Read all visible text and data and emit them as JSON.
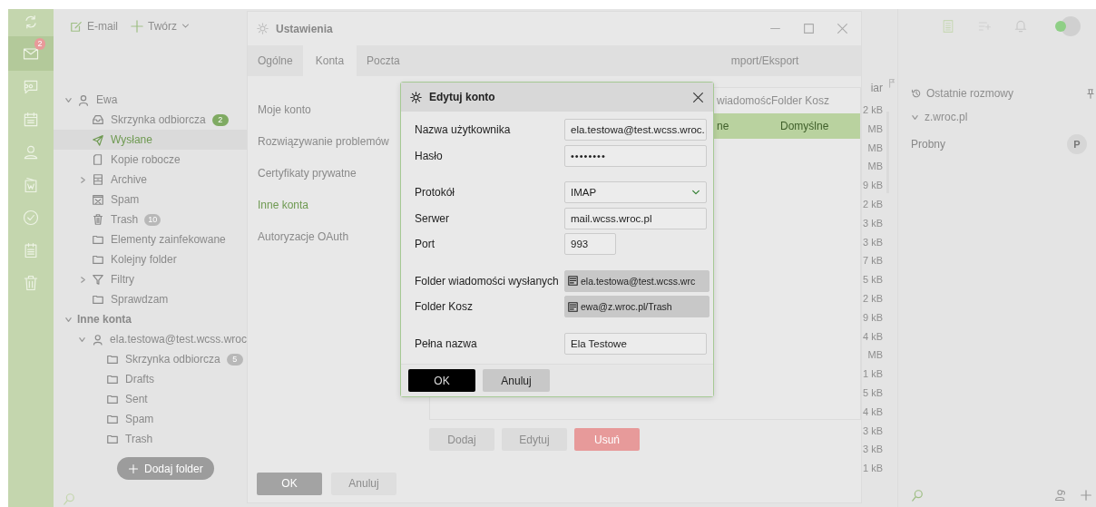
{
  "nav_rail": {
    "items": [
      {
        "kind": "sync",
        "selected": false
      },
      {
        "kind": "mail",
        "selected": true,
        "badge": "2"
      },
      {
        "kind": "chat",
        "selected": false
      },
      {
        "kind": "calendar",
        "selected": false
      },
      {
        "kind": "contacts",
        "selected": false
      },
      {
        "kind": "document",
        "selected": false
      },
      {
        "kind": "tasks",
        "selected": false
      },
      {
        "kind": "notes",
        "selected": false
      },
      {
        "kind": "trash",
        "selected": false
      }
    ]
  },
  "toolbar": {
    "email": "E-mail",
    "create": "Twórz"
  },
  "folders": {
    "tree": [
      {
        "kind": "account",
        "name": "Ewa",
        "expanded": true,
        "children": [
          {
            "kind": "inbox",
            "name": "Skrzynka odbiorcza",
            "badge": "2",
            "badge_highlighted": true,
            "selected": false
          },
          {
            "kind": "sent",
            "name": "Wysłane",
            "selected": true
          },
          {
            "kind": "drafts",
            "name": "Kopie robocze",
            "selected": false
          },
          {
            "kind": "archive",
            "name": "Archive",
            "expanded": false,
            "selected": false
          },
          {
            "kind": "spam",
            "name": "Spam",
            "selected": false
          },
          {
            "kind": "trash",
            "name": "Trash",
            "badge": "10",
            "badge_highlighted": false,
            "selected": false
          },
          {
            "kind": "folder",
            "name": "Elementy zainfekowane",
            "selected": false
          },
          {
            "kind": "folder",
            "name": "Kolejny folder",
            "selected": false
          },
          {
            "kind": "filter",
            "name": "Filtry",
            "expanded": false,
            "selected": false
          },
          {
            "kind": "folder",
            "name": "Sprawdzam",
            "selected": false
          }
        ]
      },
      {
        "kind": "group",
        "name": "Inne konta",
        "expanded": true,
        "children": [
          {
            "kind": "account",
            "name": "ela.testowa@test.wcss.wroc",
            "expanded": true,
            "children": [
              {
                "kind": "folder",
                "name": "Skrzynka odbiorcza",
                "badge": "5",
                "badge_highlighted": false,
                "selected": false
              },
              {
                "kind": "folder",
                "name": "Drafts",
                "selected": false
              },
              {
                "kind": "folder",
                "name": "Sent",
                "selected": false
              },
              {
                "kind": "folder",
                "name": "Spam",
                "selected": false
              },
              {
                "kind": "folder",
                "name": "Trash",
                "selected": false
              }
            ]
          }
        ]
      }
    ],
    "add_button": "Dodaj folder"
  },
  "message_list": {
    "size_header": "iar",
    "sizes": [
      "2 kB",
      "MB",
      "MB",
      "MB",
      "9 kB",
      "2 kB",
      "3 kB",
      "3 kB",
      "7 kB",
      "5 kB",
      "2 kB",
      "9 kB",
      "4 kB",
      "MB",
      "1 kB",
      "5 kB",
      "4 kB",
      "3 kB",
      "3 kB",
      "1 kB"
    ]
  },
  "user_status": {
    "online": true
  },
  "conversations": {
    "title": "Ostatnie rozmowy",
    "group": "z.wroc.pl",
    "expanded": true,
    "items": [
      {
        "name": "Probny",
        "initial": "P"
      }
    ]
  },
  "settings": {
    "title": "Ustawienia",
    "tabs": [
      {
        "label": "Ogólne",
        "selected": false
      },
      {
        "label": "Konta",
        "selected": true
      },
      {
        "label": "Poczta",
        "selected": false
      },
      {
        "label": "mport/Eksport",
        "selected": false
      }
    ],
    "menu": [
      {
        "label": "Moje konto",
        "selected": false
      },
      {
        "label": "Rozwiązywanie problemów",
        "selected": false
      },
      {
        "label": "Certyfikaty prywatne",
        "selected": false
      },
      {
        "label": "Inne konta",
        "selected": true
      },
      {
        "label": "Autoryzacje OAuth",
        "selected": false
      }
    ],
    "accounts_table": {
      "columns": [
        "wiadomośc",
        "Folder Kosz"
      ],
      "rows": [
        {
          "cells": [
            "ne",
            "Domyślne"
          ],
          "selected": true
        }
      ]
    },
    "actions": [
      {
        "label": "Dodaj",
        "kind": "neutral",
        "disabled": true
      },
      {
        "label": "Edytuj",
        "kind": "neutral",
        "disabled": true
      },
      {
        "label": "Usuń",
        "kind": "danger",
        "disabled": false
      }
    ],
    "footer": [
      {
        "label": "OK",
        "kind": "primary"
      },
      {
        "label": "Anuluj",
        "kind": "secondary"
      }
    ]
  },
  "edit_dialog": {
    "title": "Edytuj konto",
    "sections": [
      [
        {
          "label": "Nazwa użytkownika",
          "value": "ela.testowa@test.wcss.wroc.",
          "kind": "text"
        },
        {
          "label": "Hasło",
          "value": "••••••••",
          "kind": "password"
        }
      ],
      [
        {
          "label": "Protokół",
          "value": "IMAP",
          "kind": "select"
        },
        {
          "label": "Serwer",
          "value": "mail.wcss.wroc.pl",
          "kind": "text"
        },
        {
          "label": "Port",
          "value": "993",
          "kind": "number"
        }
      ],
      [
        {
          "label": "Folder wiadomości wysłanych",
          "value": "ela.testowa@test.wcss.wrc",
          "kind": "folder"
        },
        {
          "label": "Folder Kosz",
          "value": "ewa@z.wroc.pl/Trash",
          "kind": "folder"
        }
      ],
      [
        {
          "label": "Pełna nazwa",
          "value": "Ela Testowe",
          "kind": "text"
        }
      ]
    ],
    "buttons": [
      {
        "label": "OK",
        "kind": "primary"
      },
      {
        "label": "Anuluj",
        "kind": "secondary"
      }
    ]
  }
}
